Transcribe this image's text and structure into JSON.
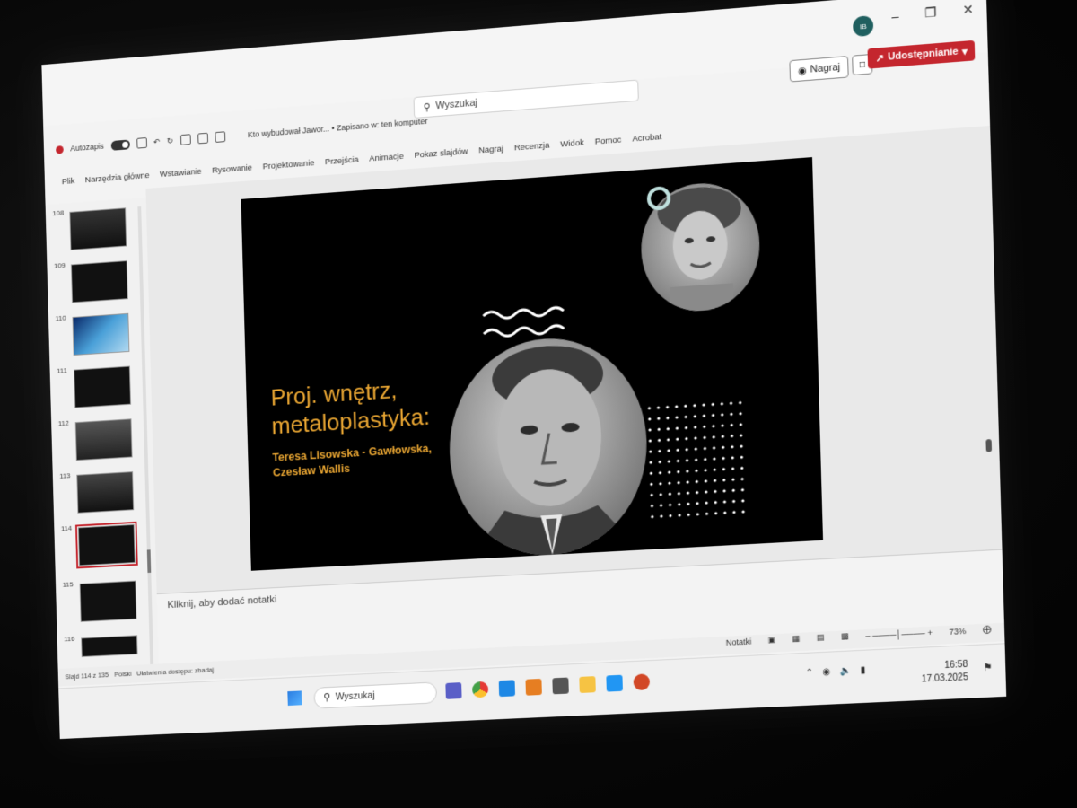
{
  "titlebar": {
    "autosave_label": "Autozapis",
    "doc_title": "Kto wybudował Jawor... • Zapisano w: ten komputer",
    "search_placeholder": "Wyszukaj",
    "avatar_initials": "IB",
    "record_label": "Nagraj",
    "share_label": "Udostępnianie"
  },
  "ribbon": {
    "tabs": [
      "Plik",
      "Narzędzia główne",
      "Wstawianie",
      "Rysowanie",
      "Projektowanie",
      "Przejścia",
      "Animacje",
      "Pokaz slajdów",
      "Nagraj",
      "Recenzja",
      "Widok",
      "Pomoc",
      "Acrobat"
    ]
  },
  "thumbnails": {
    "numbers": [
      "108",
      "109",
      "110",
      "111",
      "112",
      "113",
      "114",
      "115",
      "116"
    ],
    "active": "114"
  },
  "slide": {
    "heading_line1": "Proj. wnętrz,",
    "heading_line2": "metaloplastyka:",
    "names_line1": "Teresa Lisowska - Gawłowska,",
    "names_line2": "Czesław Wallis"
  },
  "notes": {
    "placeholder": "Kliknij, aby dodać notatki"
  },
  "status": {
    "slide_info": "Slajd 114 z 135",
    "language": "Polski",
    "accessibility": "Ułatwienia dostępu: zbadaj",
    "notes_label": "Notatki",
    "zoom": "73%"
  },
  "taskbar": {
    "search_label": "Wyszukaj",
    "time": "16:58",
    "date": "17.03.2025"
  },
  "colors": {
    "accent_red": "#c4262e",
    "slide_text": "#e8a532"
  }
}
